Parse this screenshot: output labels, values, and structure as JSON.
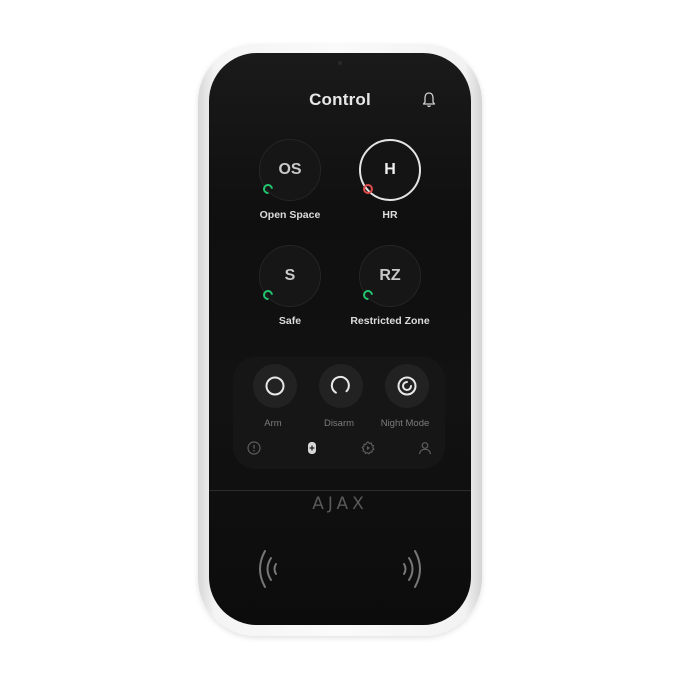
{
  "header": {
    "title": "Control",
    "bell_icon": "bell-icon"
  },
  "groups": [
    {
      "abbr": "OS",
      "name": "Open Space",
      "status_color": "#22c46e",
      "selected": false
    },
    {
      "abbr": "H",
      "name": "HR",
      "status_color": "#e14b4b",
      "selected": true
    },
    {
      "abbr": "S",
      "name": "Safe",
      "status_color": "#22c46e",
      "selected": false
    },
    {
      "abbr": "RZ",
      "name": "Restricted Zone",
      "status_color": "#22c46e",
      "selected": false
    }
  ],
  "actions": [
    {
      "label": "Arm",
      "icon": "arm-icon"
    },
    {
      "label": "Disarm",
      "icon": "disarm-icon"
    },
    {
      "label": "Night Mode",
      "icon": "night-mode-icon"
    }
  ],
  "bottom_nav": [
    {
      "icon": "alert-icon"
    },
    {
      "icon": "keypad-icon",
      "active": true
    },
    {
      "icon": "scenario-icon"
    },
    {
      "icon": "user-icon"
    }
  ],
  "brand": {
    "logo": "AJAX"
  },
  "colors": {
    "screen": "#111111",
    "armed": "#22c46e",
    "alarm": "#e14b4b",
    "frame": "#f5f5f5"
  }
}
